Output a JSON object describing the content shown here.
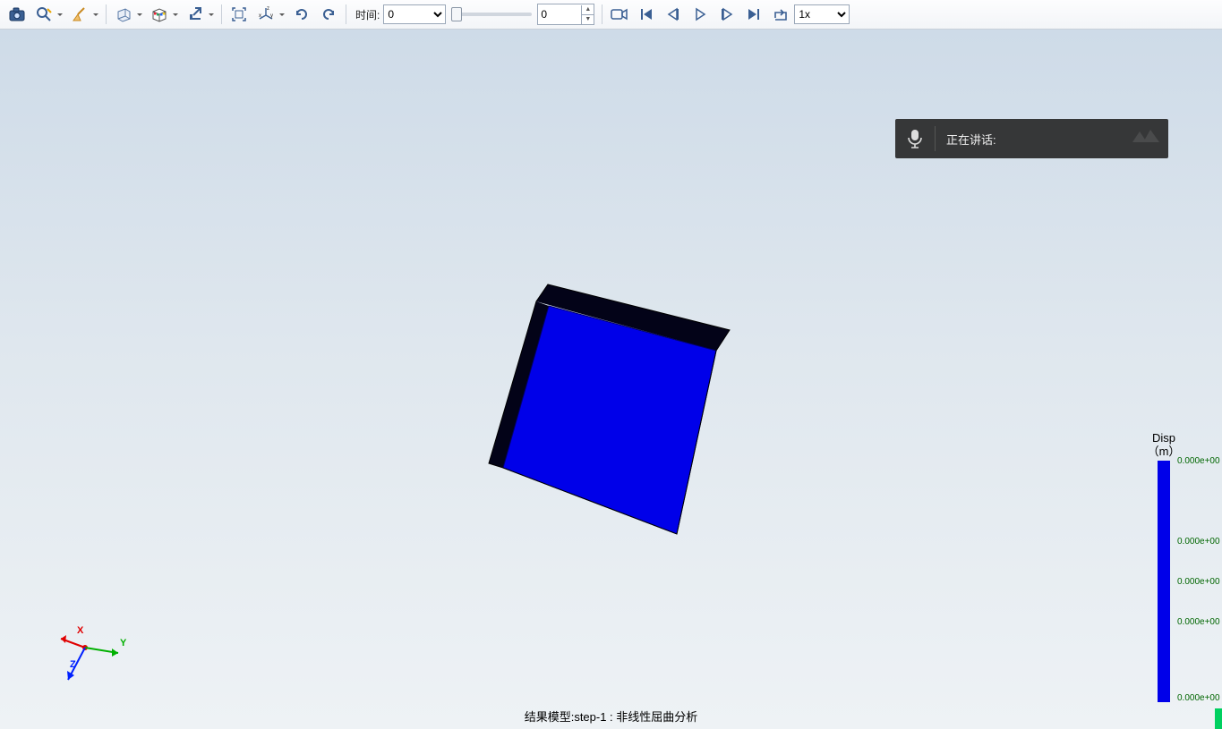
{
  "toolbar": {
    "time_label": "时间:",
    "time_select_value": "0",
    "frame_value": "0",
    "speed_value": "1x"
  },
  "voice_overlay": {
    "label": "正在讲话:"
  },
  "legend": {
    "title_line1": "Disp",
    "title_line2": "（m）",
    "ticks": [
      "0.000e+00",
      "0.000e+00",
      "0.000e+00",
      "0.000e+00",
      "0.000e+00"
    ]
  },
  "caption": "结果模型:step-1 : 非线性屈曲分析",
  "axes": {
    "x": "X",
    "y": "Y",
    "z": "Z"
  }
}
